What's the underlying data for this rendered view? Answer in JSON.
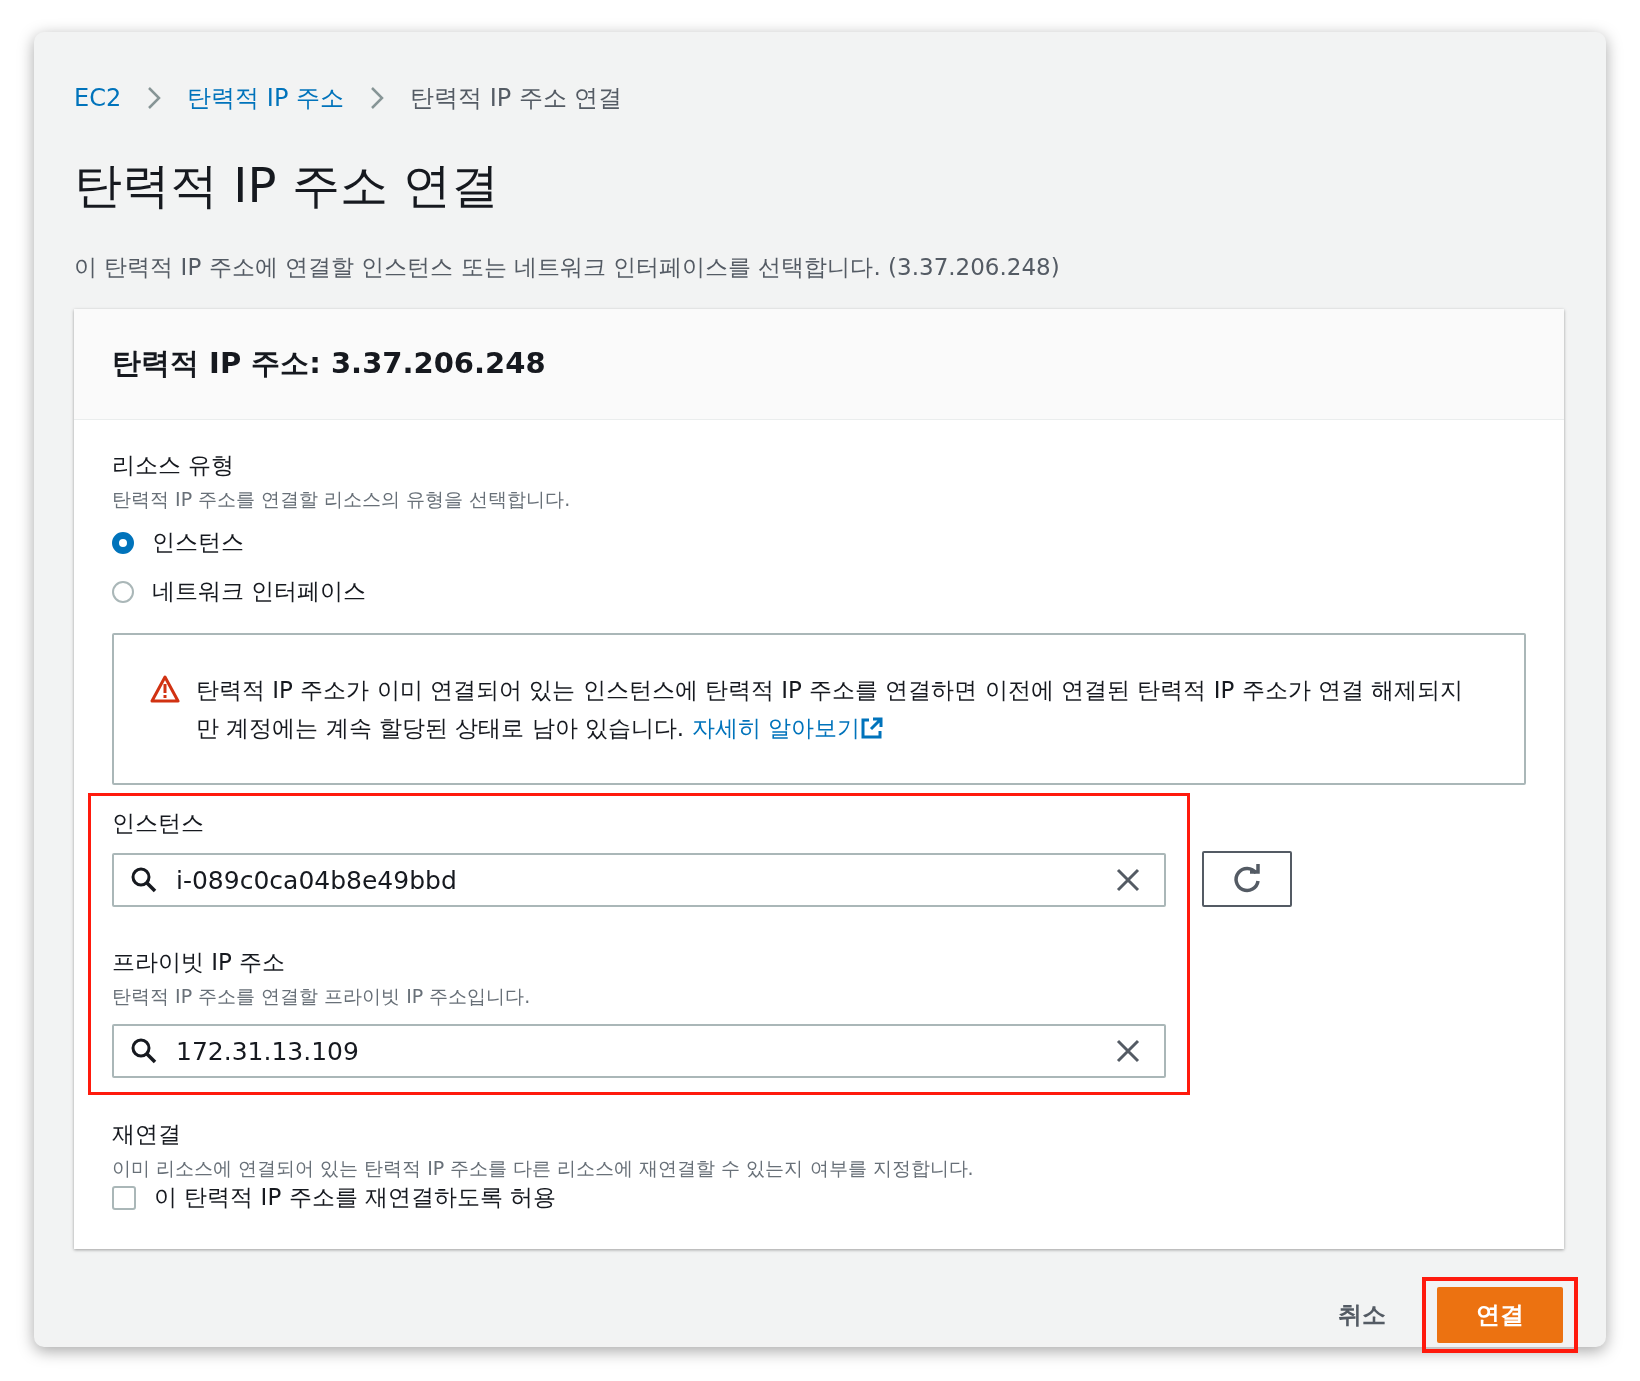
{
  "breadcrumb": [
    {
      "label": "EC2",
      "link": true
    },
    {
      "label": "탄력적 IP 주소",
      "link": true
    },
    {
      "label": "탄력적 IP 주소 연결",
      "link": false
    }
  ],
  "title": "탄력적 IP 주소 연결",
  "description": "이 탄력적 IP 주소에 연결할 인스턴스 또는 네트워크 인터페이스를 선택합니다. (3.37.206.248)",
  "panel": {
    "header": "탄력적 IP 주소: 3.37.206.248",
    "resource_type": {
      "label": "리소스 유형",
      "hint": "탄력적 IP 주소를 연결할 리소스의 유형을 선택합니다.",
      "options": [
        {
          "label": "인스턴스",
          "selected": true
        },
        {
          "label": "네트워크 인터페이스",
          "selected": false
        }
      ]
    },
    "alert": {
      "text": "탄력적 IP 주소가 이미 연결되어 있는 인스턴스에 탄력적 IP 주소를 연결하면 이전에 연결된 탄력적 IP 주소가 연결 해제되지만 계정에는 계속 할당된 상태로 남아 있습니다.",
      "link": "자세히 알아보기"
    },
    "instance_section": {
      "highlighted": true,
      "instance": {
        "label": "인스턴스",
        "value": "i-089c0ca04b8e49bbd"
      },
      "private_ip": {
        "label": "프라이빗 IP 주소",
        "hint": "탄력적 IP 주소를 연결할 프라이빗 IP 주소입니다.",
        "value": "172.31.13.109"
      }
    },
    "reassociation": {
      "label": "재연결",
      "hint": "이미 리소스에 연결되어 있는 탄력적 IP 주소를 다른 리소스에 재연결할 수 있는지 여부를 지정합니다.",
      "checkbox": {
        "label": "이 탄력적 IP 주소를 재연결하도록 허용",
        "checked": false
      }
    }
  },
  "footer": {
    "cancel": "취소",
    "submit": {
      "label": "연결",
      "highlighted": true
    }
  }
}
